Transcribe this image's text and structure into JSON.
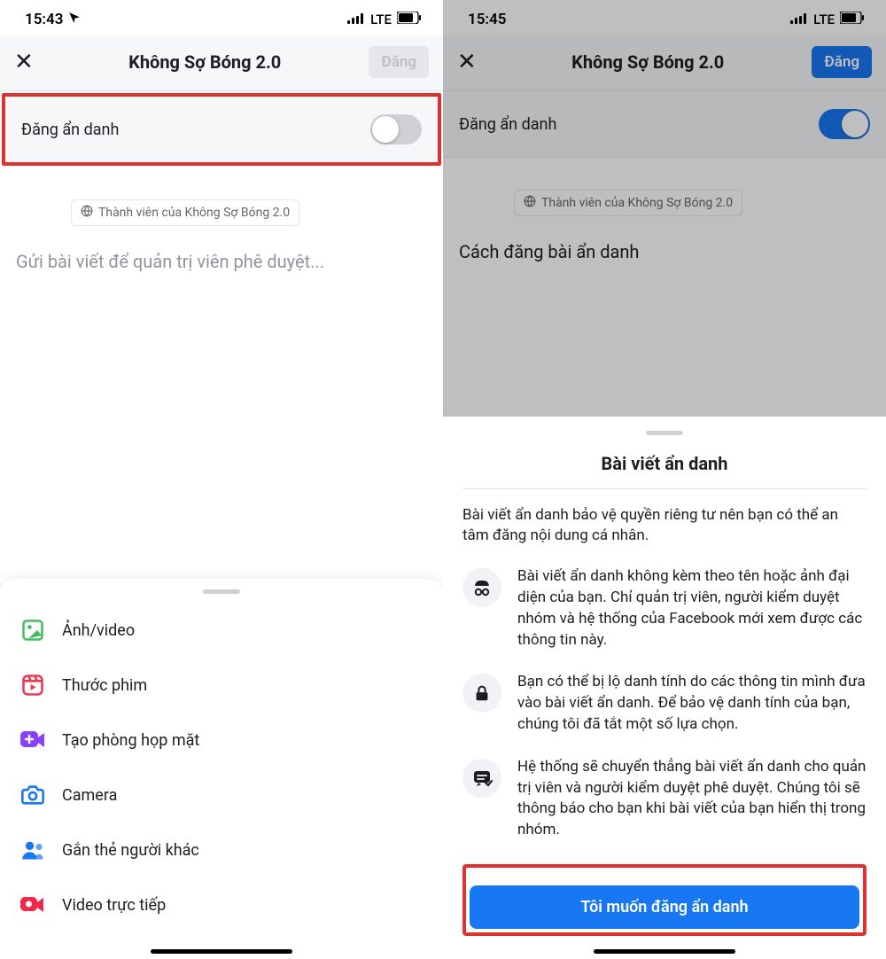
{
  "left": {
    "status": {
      "time": "15:43",
      "net": "LTE"
    },
    "header": {
      "title": "Không Sợ Bóng 2.0",
      "post": "Đăng"
    },
    "anon": {
      "label": "Đăng ẩn danh"
    },
    "member_chip": "Thành viên của Không Sợ Bóng 2.0",
    "composer_placeholder": "Gửi bài viết để quản trị viên phê duyệt...",
    "sheet": {
      "items": [
        {
          "label": "Ảnh/video",
          "icon": "photo"
        },
        {
          "label": "Thước phim",
          "icon": "reels"
        },
        {
          "label": "Tạo phòng họp mặt",
          "icon": "room"
        },
        {
          "label": "Camera",
          "icon": "camera"
        },
        {
          "label": "Gắn thẻ người khác",
          "icon": "tag"
        },
        {
          "label": "Video trực tiếp",
          "icon": "live"
        }
      ]
    }
  },
  "right": {
    "status": {
      "time": "15:45",
      "net": "LTE"
    },
    "header": {
      "title": "Không Sợ Bóng 2.0",
      "post": "Đăng"
    },
    "anon": {
      "label": "Đăng ẩn danh"
    },
    "member_chip": "Thành viên của Không Sợ Bóng 2.0",
    "composer_text": "Cách đăng bài ẩn danh",
    "modal": {
      "title": "Bài viết ẩn danh",
      "intro": "Bài viết ẩn danh bảo vệ quyền riêng tư nên bạn có thể an tâm đăng nội dung cá nhân.",
      "rows": [
        "Bài viết ẩn danh không kèm theo tên hoặc ảnh đại diện của bạn. Chỉ quản trị viên, người kiểm duyệt nhóm và hệ thống của Facebook mới xem được các thông tin này.",
        "Bạn có thể bị lộ danh tính do các thông tin mình đưa vào bài viết ẩn danh. Để bảo vệ danh tính của bạn, chúng tôi đã tắt một số lựa chọn.",
        "Hệ thống sẽ chuyển thẳng bài viết ẩn danh cho quản trị viên và người kiểm duyệt phê duyệt. Chúng tôi sẽ thông báo cho bạn khi bài viết của bạn hiển thị trong nhóm."
      ],
      "cta": "Tôi muốn đăng ẩn danh"
    }
  }
}
